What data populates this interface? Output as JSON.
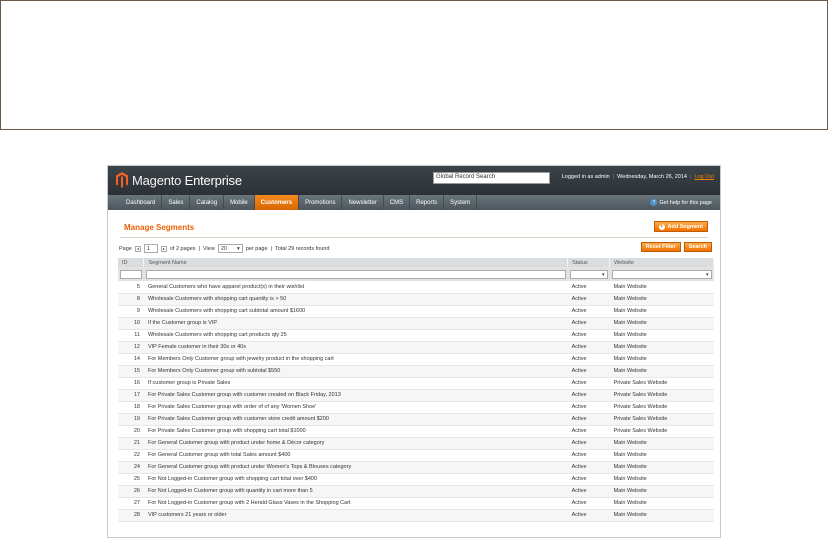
{
  "header": {
    "logo_brand": "Magento",
    "logo_suffix": " Enterprise",
    "search_value": "Global Record Search",
    "logged_in": "Logged in as admin",
    "date": "Wednesday, March 26, 2014",
    "logout": "Log Out"
  },
  "nav": {
    "items": [
      "Dashboard",
      "Sales",
      "Catalog",
      "Mobile",
      "Customers",
      "Promotions",
      "Newsletter",
      "CMS",
      "Reports",
      "System"
    ],
    "active": "Customers",
    "help": "Get help for this page"
  },
  "page": {
    "title": "Manage Segments",
    "add_button": "Add Segment"
  },
  "pager": {
    "page_label": "Page",
    "page_value": "1",
    "of_pages": "of 2 pages",
    "view_label": "View",
    "per_page_value": "20",
    "per_page_label": "per page",
    "total": "Total 29 records found",
    "reset_filter": "Reset Filter",
    "search": "Search"
  },
  "grid": {
    "columns": [
      "ID",
      "Segment Name",
      "Status",
      "Website"
    ],
    "rows": [
      {
        "id": "5",
        "name": "General Customers who have apparel product(s) in their wishlist",
        "status": "Active",
        "website": "Main Website"
      },
      {
        "id": "8",
        "name": "Wholesale Customers with shopping cart quantity is > 50",
        "status": "Active",
        "website": "Main Website"
      },
      {
        "id": "9",
        "name": "Wholesale Customers with shopping cart subtotal amount $1600",
        "status": "Active",
        "website": "Main Website"
      },
      {
        "id": "10",
        "name": "If the Customer group is VIP",
        "status": "Active",
        "website": "Main Website"
      },
      {
        "id": "11",
        "name": "Wholesale Customers with shopping cart products qty 25",
        "status": "Active",
        "website": "Main Website"
      },
      {
        "id": "12",
        "name": "VIP Female customer in their 30s or 40s",
        "status": "Active",
        "website": "Main Website"
      },
      {
        "id": "14",
        "name": "For Members Only Customer group with jewelry product in the shopping cart",
        "status": "Active",
        "website": "Main Website"
      },
      {
        "id": "15",
        "name": "For Members Only Customer group with subtotal $550",
        "status": "Active",
        "website": "Main Website"
      },
      {
        "id": "16",
        "name": "If customer group is Private Sales",
        "status": "Active",
        "website": "Private Sales Website"
      },
      {
        "id": "17",
        "name": "For Private Sales Customer group with customer created on Black Friday, 2013",
        "status": "Active",
        "website": "Private Sales Website"
      },
      {
        "id": "18",
        "name": "For Private Sales Customer group with order of of any 'Women Shoe'",
        "status": "Active",
        "website": "Private Sales Website"
      },
      {
        "id": "19",
        "name": "For Private Sales Customer group with customer store credit amount $200",
        "status": "Active",
        "website": "Private Sales Website"
      },
      {
        "id": "20",
        "name": "For Private Sales Customer group with shopping cart total $1000",
        "status": "Active",
        "website": "Private Sales Website"
      },
      {
        "id": "21",
        "name": "For General Customer group with product under home & Décor category",
        "status": "Active",
        "website": "Main Website"
      },
      {
        "id": "22",
        "name": "For General Customer group with total Sales amount $400",
        "status": "Active",
        "website": "Main Website"
      },
      {
        "id": "24",
        "name": "For General Customer group with product under Women's Tops & Blouses category",
        "status": "Active",
        "website": "Main Website"
      },
      {
        "id": "25",
        "name": "For Not Logged-in Customer group with shopping cart total over $400",
        "status": "Active",
        "website": "Main Website"
      },
      {
        "id": "26",
        "name": "For Not Logged-in Customer group with quantity in cart more than 5",
        "status": "Active",
        "website": "Main Website"
      },
      {
        "id": "27",
        "name": "For Not Logged-in Customer group with 2 Herald Glass Vases in the Shopping Cart",
        "status": "Active",
        "website": "Main Website"
      },
      {
        "id": "28",
        "name": "VIP customers 21 years or older",
        "status": "Active",
        "website": "Main Website"
      }
    ]
  },
  "colors": {
    "accent": "#eb5e00",
    "header_bg": "#2b3136",
    "nav_bg": "#4d565c",
    "button_orange": "#f27000"
  }
}
